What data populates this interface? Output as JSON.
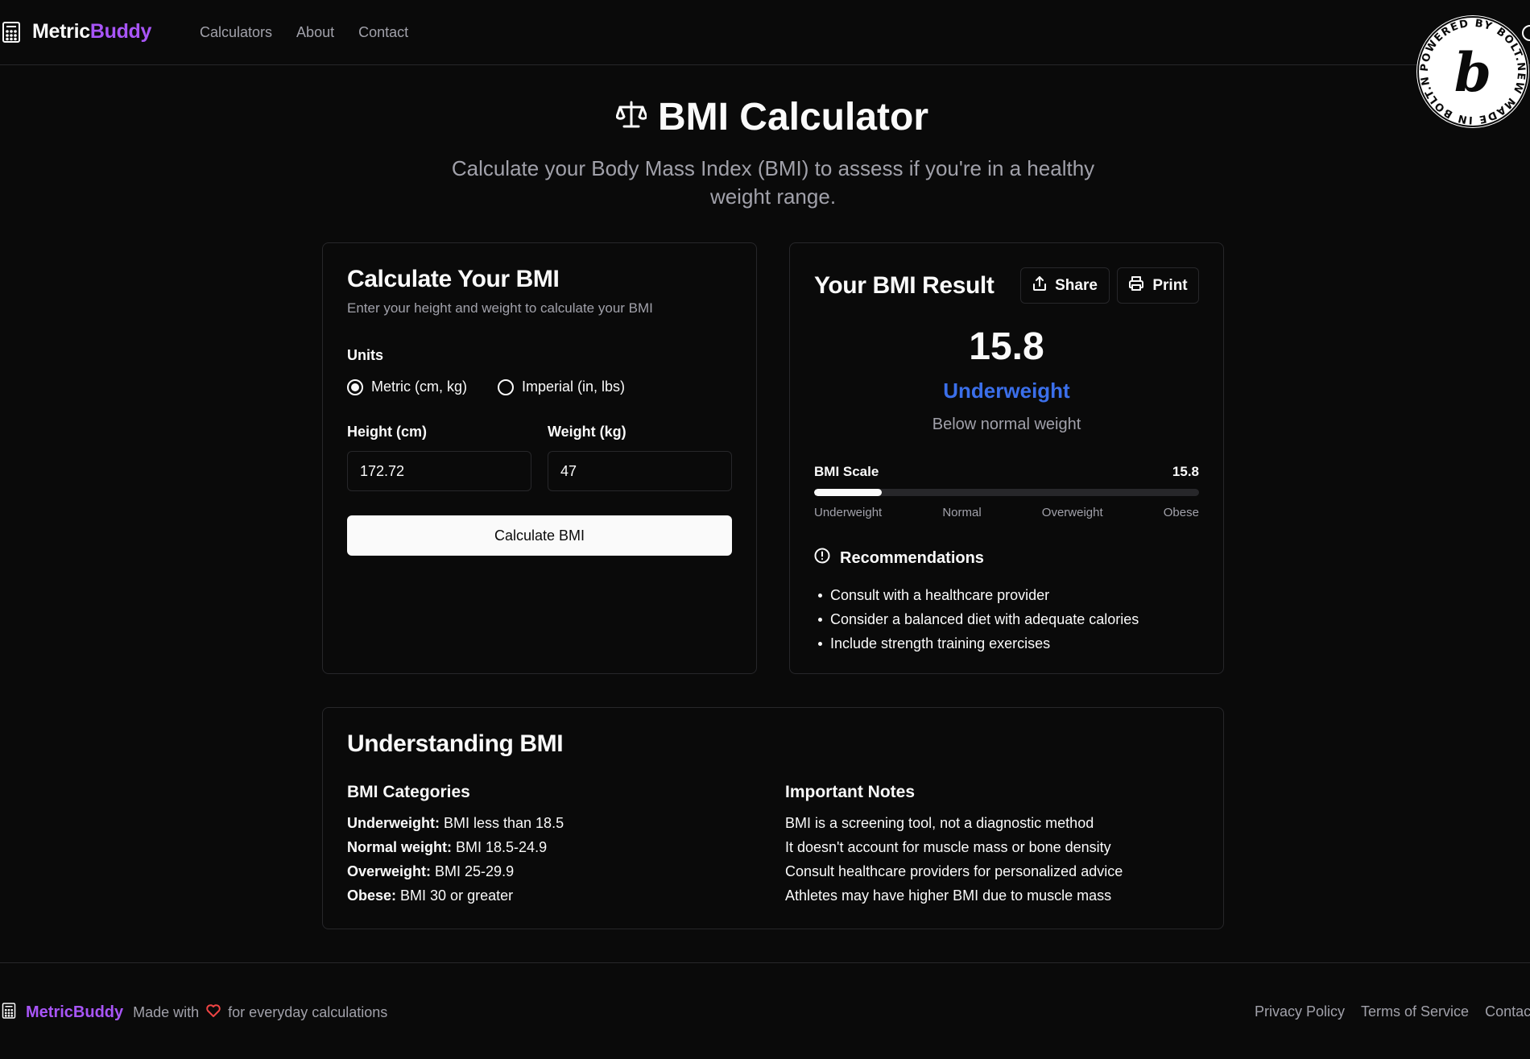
{
  "header": {
    "brand_prefix": "Metric",
    "brand_suffix": "Buddy",
    "nav": [
      "Calculators",
      "About",
      "Contact"
    ],
    "badge_text": "POWERED BY BOLT.NEW MADE IN BOLT.NEW ",
    "badge_letter": "b"
  },
  "hero": {
    "title": "BMI Calculator",
    "subtitle": "Calculate your Body Mass Index (BMI) to assess if you're in a healthy weight range."
  },
  "calculator": {
    "title": "Calculate Your BMI",
    "description": "Enter your height and weight to calculate your BMI",
    "units_label": "Units",
    "unit_options": [
      {
        "label": "Metric (cm, kg)",
        "checked": true
      },
      {
        "label": "Imperial (in, lbs)",
        "checked": false
      }
    ],
    "height_label": "Height (cm)",
    "height_value": "172.72",
    "weight_label": "Weight (kg)",
    "weight_value": "47",
    "button_label": "Calculate BMI"
  },
  "result": {
    "title": "Your BMI Result",
    "share_label": "Share",
    "print_label": "Print",
    "value": "15.8",
    "category": "Underweight",
    "category_color": "#3b6fea",
    "description": "Below normal weight",
    "scale_label": "BMI Scale",
    "scale_value": "15.8",
    "scale_fraction": 0.175,
    "scale_ticks": [
      "Underweight",
      "Normal",
      "Overweight",
      "Obese"
    ],
    "recommendations_title": "Recommendations",
    "recommendations": [
      "Consult with a healthcare provider",
      "Consider a balanced diet with adequate calories",
      "Include strength training exercises"
    ]
  },
  "info": {
    "title": "Understanding BMI",
    "categories_title": "BMI Categories",
    "categories": [
      {
        "term": "Underweight:",
        "desc": " BMI less than 18.5"
      },
      {
        "term": "Normal weight:",
        "desc": " BMI 18.5-24.9"
      },
      {
        "term": "Overweight:",
        "desc": " BMI 25-29.9"
      },
      {
        "term": "Obese:",
        "desc": " BMI 30 or greater"
      }
    ],
    "notes_title": "Important Notes",
    "notes": [
      "BMI is a screening tool, not a diagnostic method",
      "It doesn't account for muscle mass or bone density",
      "Consult healthcare providers for personalized advice",
      "Athletes may have higher BMI due to muscle mass"
    ]
  },
  "footer": {
    "brand": "MetricBuddy",
    "made_with": "Made with",
    "tagline": "for everyday calculations",
    "links": [
      "Privacy Policy",
      "Terms of Service",
      "Contact"
    ]
  }
}
